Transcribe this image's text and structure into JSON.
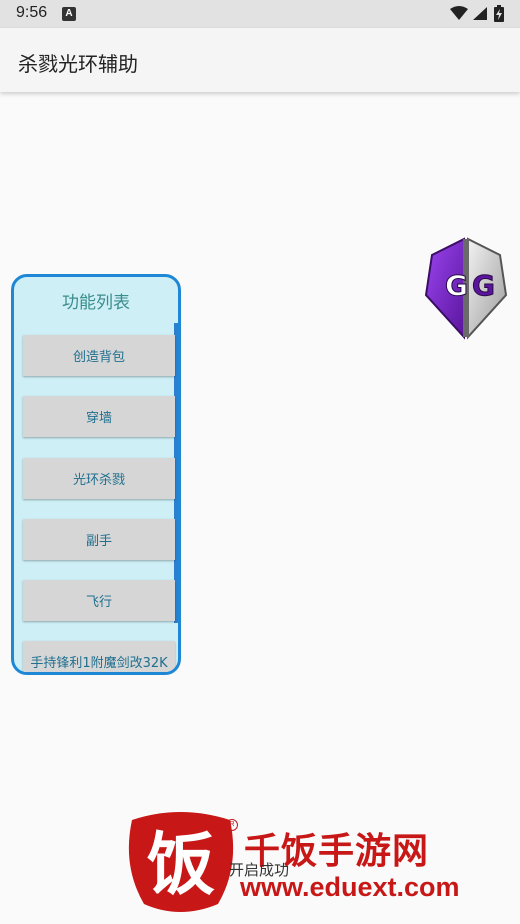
{
  "status_bar": {
    "time": "9:56",
    "notification_icon_letter": "A",
    "icons": [
      "wifi-icon",
      "signal-icon",
      "battery-charging-icon"
    ]
  },
  "app_bar": {
    "title": "杀戮光环辅助"
  },
  "overlay_icon": {
    "icon": "gameguardian-icon",
    "text": "GG",
    "colors": [
      "#7b2fd1",
      "#d7d7d7"
    ]
  },
  "panel": {
    "title": "功能列表",
    "buttons": [
      {
        "label": "创造背包"
      },
      {
        "label": "穿墙"
      },
      {
        "label": "光环杀戮"
      },
      {
        "label": "副手"
      },
      {
        "label": "飞行"
      },
      {
        "label": "手持锋利1附魔剑改32K"
      }
    ]
  },
  "toast": {
    "text": "开启成功"
  },
  "watermark": {
    "logo_char": "饭",
    "name": "千饭手游网",
    "url": "www.eduext.com",
    "registered_mark": "R"
  },
  "colors": {
    "panel_border": "#1e88d6",
    "panel_bg": "#cdeff5",
    "panel_title": "#3b8d8d",
    "button_bg": "#d6d6d6",
    "watermark_red": "#c71717"
  }
}
